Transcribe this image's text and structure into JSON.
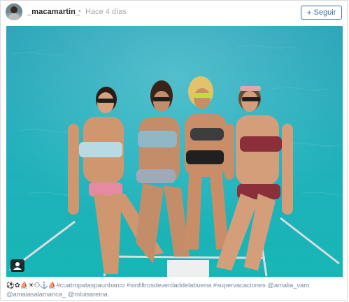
{
  "post": {
    "username": "_macamartin_",
    "separator": "•",
    "timestamp": "Hace 4 días",
    "follow_label": "Seguir",
    "follow_plus": "+"
  },
  "caption": {
    "emojis": "⚽✿⛵☀⚇⚓⛵",
    "hashtags": [
      "#cuatropataspaunbarco",
      "#sinfiltrosdeverdaddelabuena",
      "#supervacaciones"
    ],
    "mentions": [
      "@amalia_varo",
      "@amaiasalamanca_",
      "@mluisareina"
    ]
  },
  "icons": {
    "avatar": "user-avatar",
    "tag": "people-tag-icon"
  },
  "colors": {
    "link": "#3f729b",
    "sea": "#22a9b5",
    "caption_text": "#7b8ea6"
  }
}
